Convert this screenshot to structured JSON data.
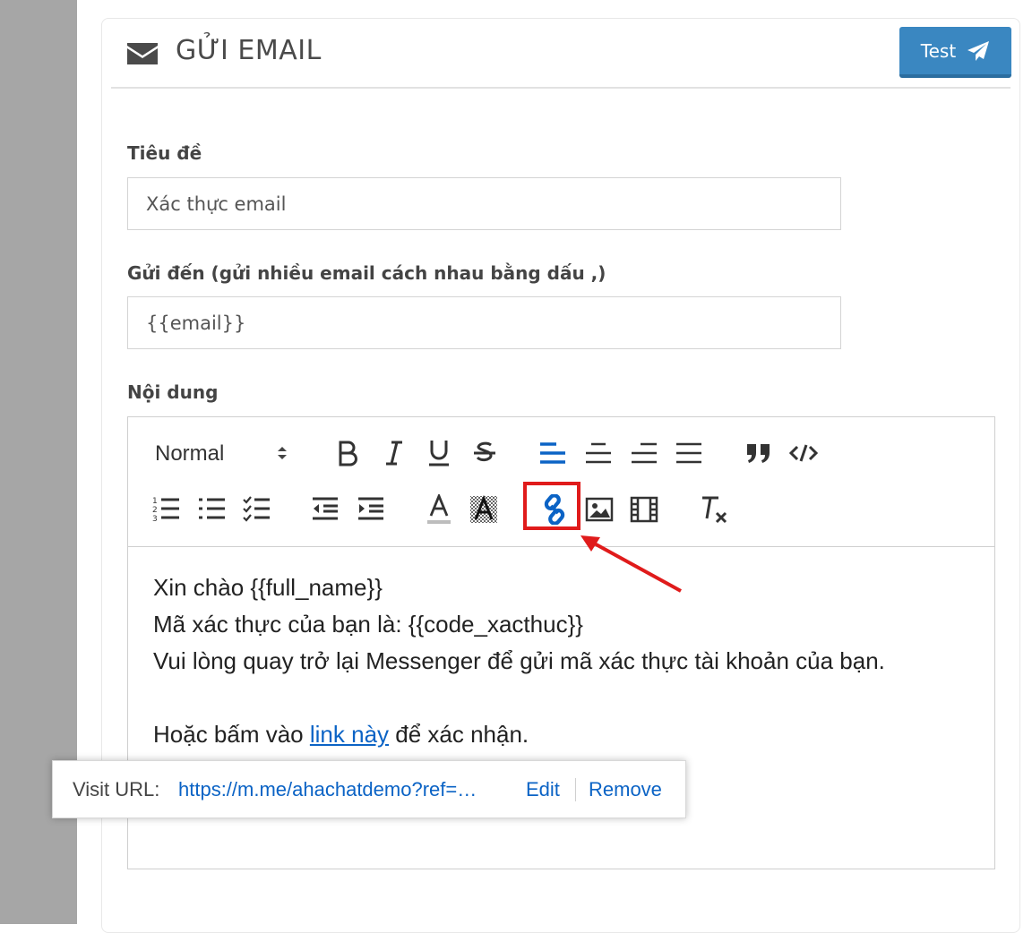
{
  "panel": {
    "title": "GỬI EMAIL",
    "test_button_label": "Test"
  },
  "form": {
    "subject_label": "Tiêu đề",
    "subject_value": "Xác thực email",
    "to_label": "Gửi đến (gửi nhiều email cách nhau bằng dấu ,)",
    "to_value": "{{email}}",
    "content_label": "Nội dung"
  },
  "toolbar": {
    "format_value": "Normal",
    "row1_icons": [
      "bold-icon",
      "italic-icon",
      "underline-icon",
      "strikethrough-icon",
      "align-left-icon",
      "align-center-icon",
      "align-right-icon",
      "align-justify-icon",
      "blockquote-icon",
      "code-block-icon"
    ],
    "row2_icons": [
      "ordered-list-icon",
      "bullet-list-icon",
      "check-list-icon",
      "outdent-icon",
      "indent-icon",
      "text-color-icon",
      "background-color-icon",
      "link-icon",
      "image-icon",
      "video-icon",
      "clear-format-icon"
    ]
  },
  "editor": {
    "line1": "Xin chào {{full_name}}",
    "line2": "Mã xác thực của bạn là: {{code_xacthuc}}",
    "line3": "Vui lòng quay trở lại Messenger để gửi mã xác thực tài khoản của bạn.",
    "line4_prefix": "Hoặc bấm vào ",
    "line4_link": "link này",
    "line4_suffix": " để xác nhận."
  },
  "link_tooltip": {
    "label": "Visit URL:",
    "url": "https://m.me/ahachatdemo?ref=…",
    "edit": "Edit",
    "remove": "Remove"
  },
  "colors": {
    "accent": "#3a87c1",
    "link": "#0b63c5",
    "highlight": "#e01b1b",
    "active_align": "#0b63c5"
  }
}
